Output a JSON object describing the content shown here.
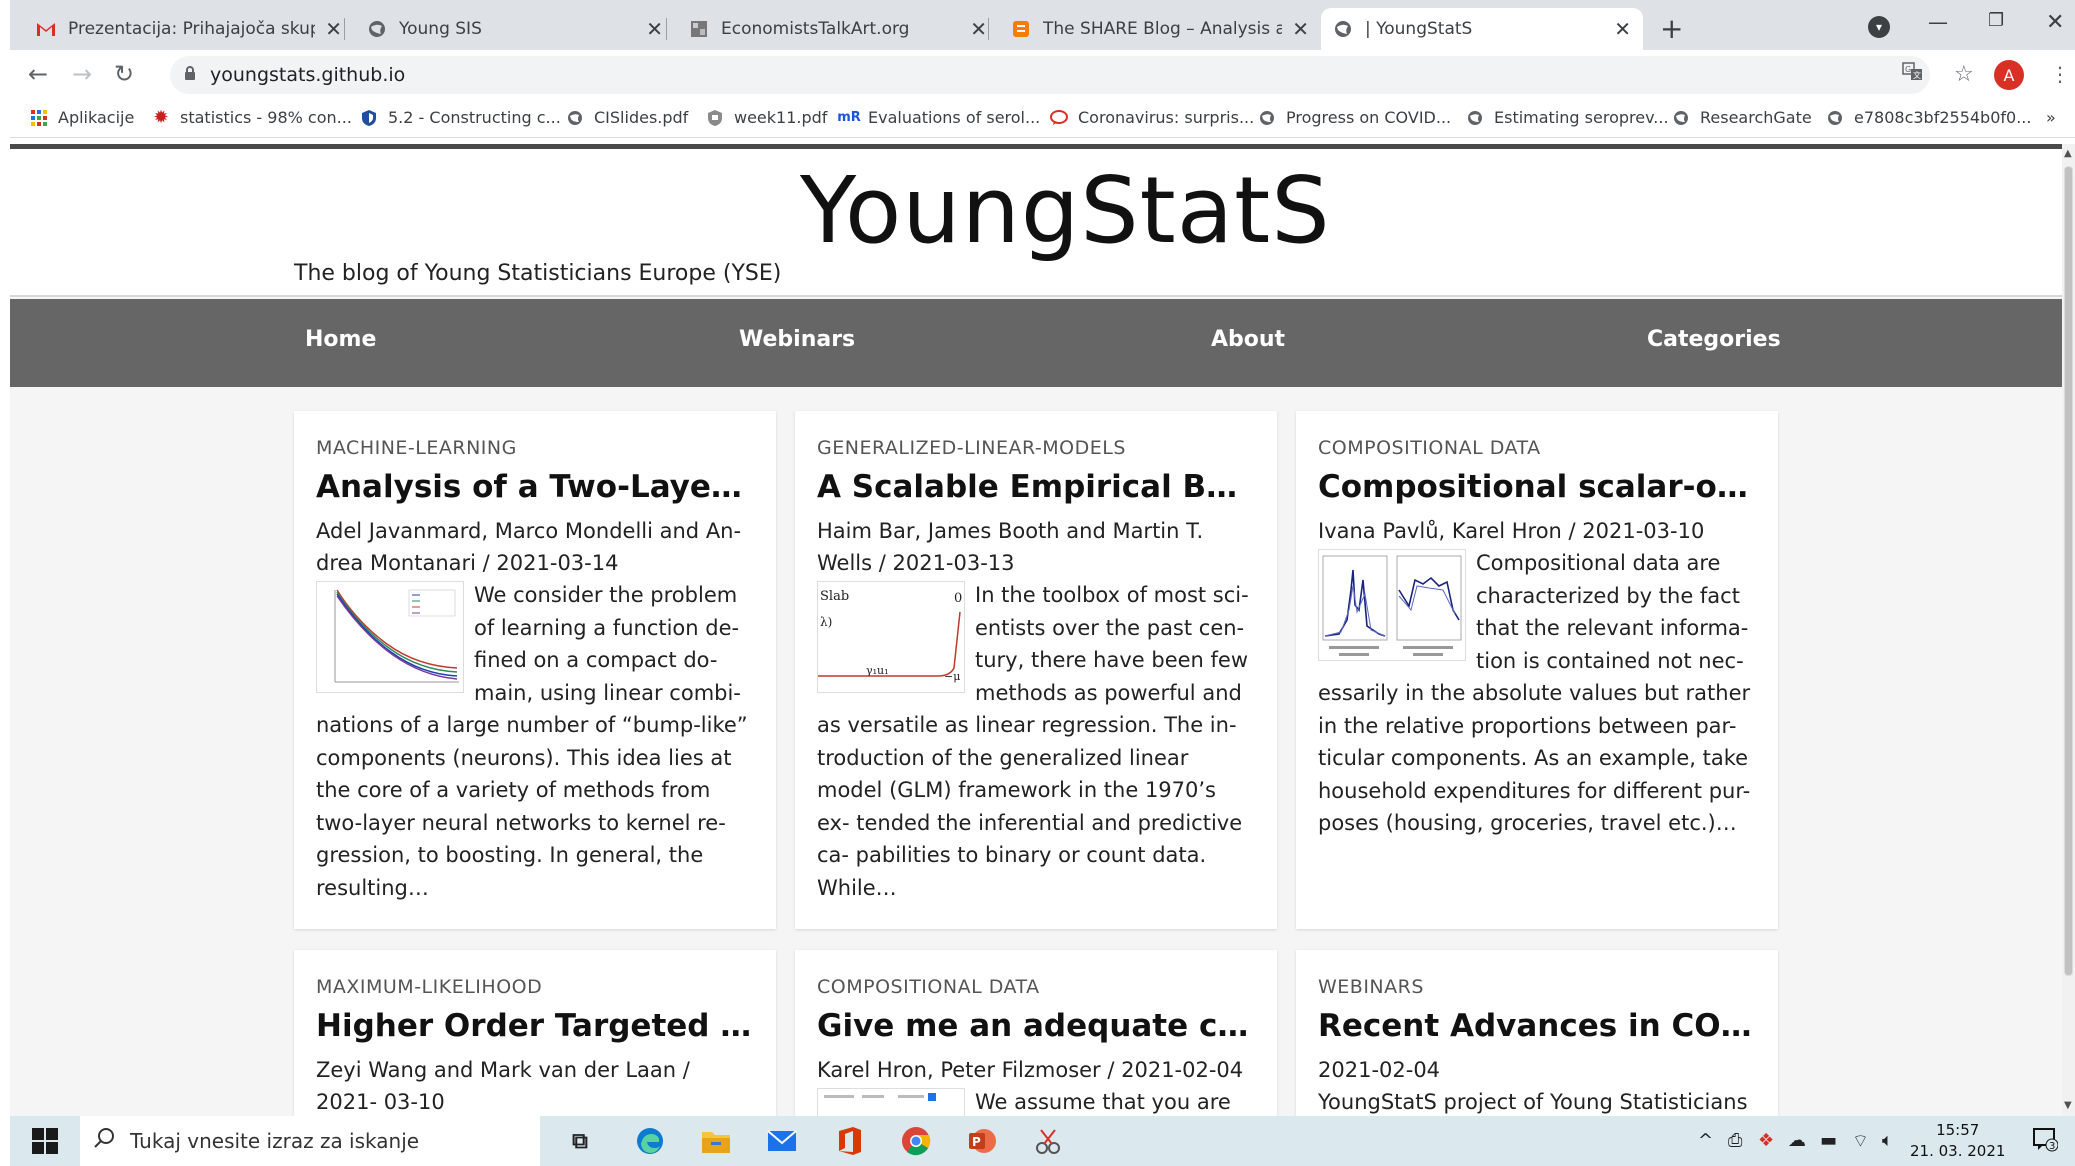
{
  "browser": {
    "tabs": [
      {
        "title": "Prezentacija: Prihajajoča skupščin",
        "icon": "gmail-icon",
        "active": false
      },
      {
        "title": "Young SIS",
        "icon": "globe-icon",
        "active": false
      },
      {
        "title": "EconomistsTalkArt.org",
        "icon": "site-image-icon",
        "active": false
      },
      {
        "title": "The SHARE Blog – Analysis and c",
        "icon": "blogger-icon",
        "active": false
      },
      {
        "title": "| YoungStatS",
        "icon": "globe-icon",
        "active": true
      }
    ],
    "url": "youngstats.github.io",
    "profile_initial": "A",
    "bookmarks": [
      {
        "label": "Aplikacije",
        "icon": "apps-grid-icon"
      },
      {
        "label": "statistics - 98% con...",
        "icon": "gear-red-icon"
      },
      {
        "label": "5.2 - Constructing c...",
        "icon": "shield-icon"
      },
      {
        "label": "CISlides.pdf",
        "icon": "globe-icon"
      },
      {
        "label": "week11.pdf",
        "icon": "crest-icon"
      },
      {
        "label": "Evaluations of serol...",
        "icon": "mr-icon"
      },
      {
        "label": "Coronavirus: surpris...",
        "icon": "speech-bubble-icon"
      },
      {
        "label": "Progress on COVID...",
        "icon": "globe-icon"
      },
      {
        "label": "Estimating seroprev...",
        "icon": "globe-icon"
      },
      {
        "label": "ResearchGate",
        "icon": "globe-icon"
      },
      {
        "label": "e7808c3bf2554b0f0...",
        "icon": "globe-icon"
      }
    ],
    "bookmarks_overflow": "»"
  },
  "site": {
    "title": "YoungStatS",
    "subtitle": "The blog of Young Statisticians Europe (YSE)",
    "nav": [
      "Home",
      "Webinars",
      "About",
      "Categories"
    ]
  },
  "posts": [
    {
      "category": "MACHINE-LEARNING",
      "title": "Analysis of a Two-Layer…",
      "meta": "Adel Javanmard, Marco Mondelli and An- drea Montanari / 2021-03-14",
      "excerpt": "We consider the problem of learning a function de- fined on a compact do- main, using linear combi- nations of a large number of “bump-like” components (neurons). This idea lies at the core of a variety of methods from two-layer neural networks to kernel re- gression, to boosting. In general, the resulting…",
      "thumbnail": "line-chart-thumbnail"
    },
    {
      "category": "GENERALIZED-LINEAR-MODELS",
      "title": "A Scalable Empirical Bay…",
      "meta": "Haim Bar, James Booth and Martin T. Wells / 2021-03-13",
      "excerpt": "In the toolbox of most sci- entists over the past cen- tury, there have been few methods as powerful and as versatile as linear regression. The in- troduction of the generalized linear model (GLM) framework in the 1970’s ex- tended the inferential and predictive ca- pabilities to binary or count data. While…",
      "thumbnail": "slab-diagram-thumbnail",
      "thumb_text": [
        "Slab",
        "0",
        "λ)",
        "γ₁u₁",
        "−μ"
      ]
    },
    {
      "category": "COMPOSITIONAL DATA",
      "title": "Compositional scalar-on…",
      "meta": "Ivana Pavlů, Karel Hron / 2021-03-10",
      "excerpt": "Compositional data are characterized by the fact that the relevant informa- tion is contained not nec- essarily in the absolute values but rather in the relative proportions between par- ticular components. As an example, take household expenditures for different pur- poses (housing, groceries, travel etc.)…",
      "thumbnail": "spectra-plot-thumbnail"
    },
    {
      "category": "MAXIMUM-LIKELIHOOD",
      "title": "Higher Order Targeted …",
      "meta": "Zeyi Wang and Mark van der Laan / 2021- 03-10",
      "excerpt": ""
    },
    {
      "category": "COMPOSITIONAL DATA",
      "title": "Give me an adequate co…",
      "meta": "Karel Hron, Peter Filzmoser / 2021-02-04",
      "excerpt": "We assume that you are",
      "thumbnail": "table-thumbnail"
    },
    {
      "category": "WEBINARS",
      "title": "Recent Advances in CO…",
      "meta": "2021-02-04",
      "excerpt": "YoungStatS project of Young Statisticians"
    }
  ],
  "taskbar": {
    "search_placeholder": "Tukaj vnesite izraz za iskanje",
    "apps": [
      "task-view-icon",
      "edge-icon",
      "file-explorer-icon",
      "mail-icon",
      "office-icon",
      "chrome-icon",
      "powerpoint-icon",
      "snipping-tool-icon"
    ],
    "time": "15:57",
    "date": "21. 03. 2021",
    "notification_count": "3"
  }
}
